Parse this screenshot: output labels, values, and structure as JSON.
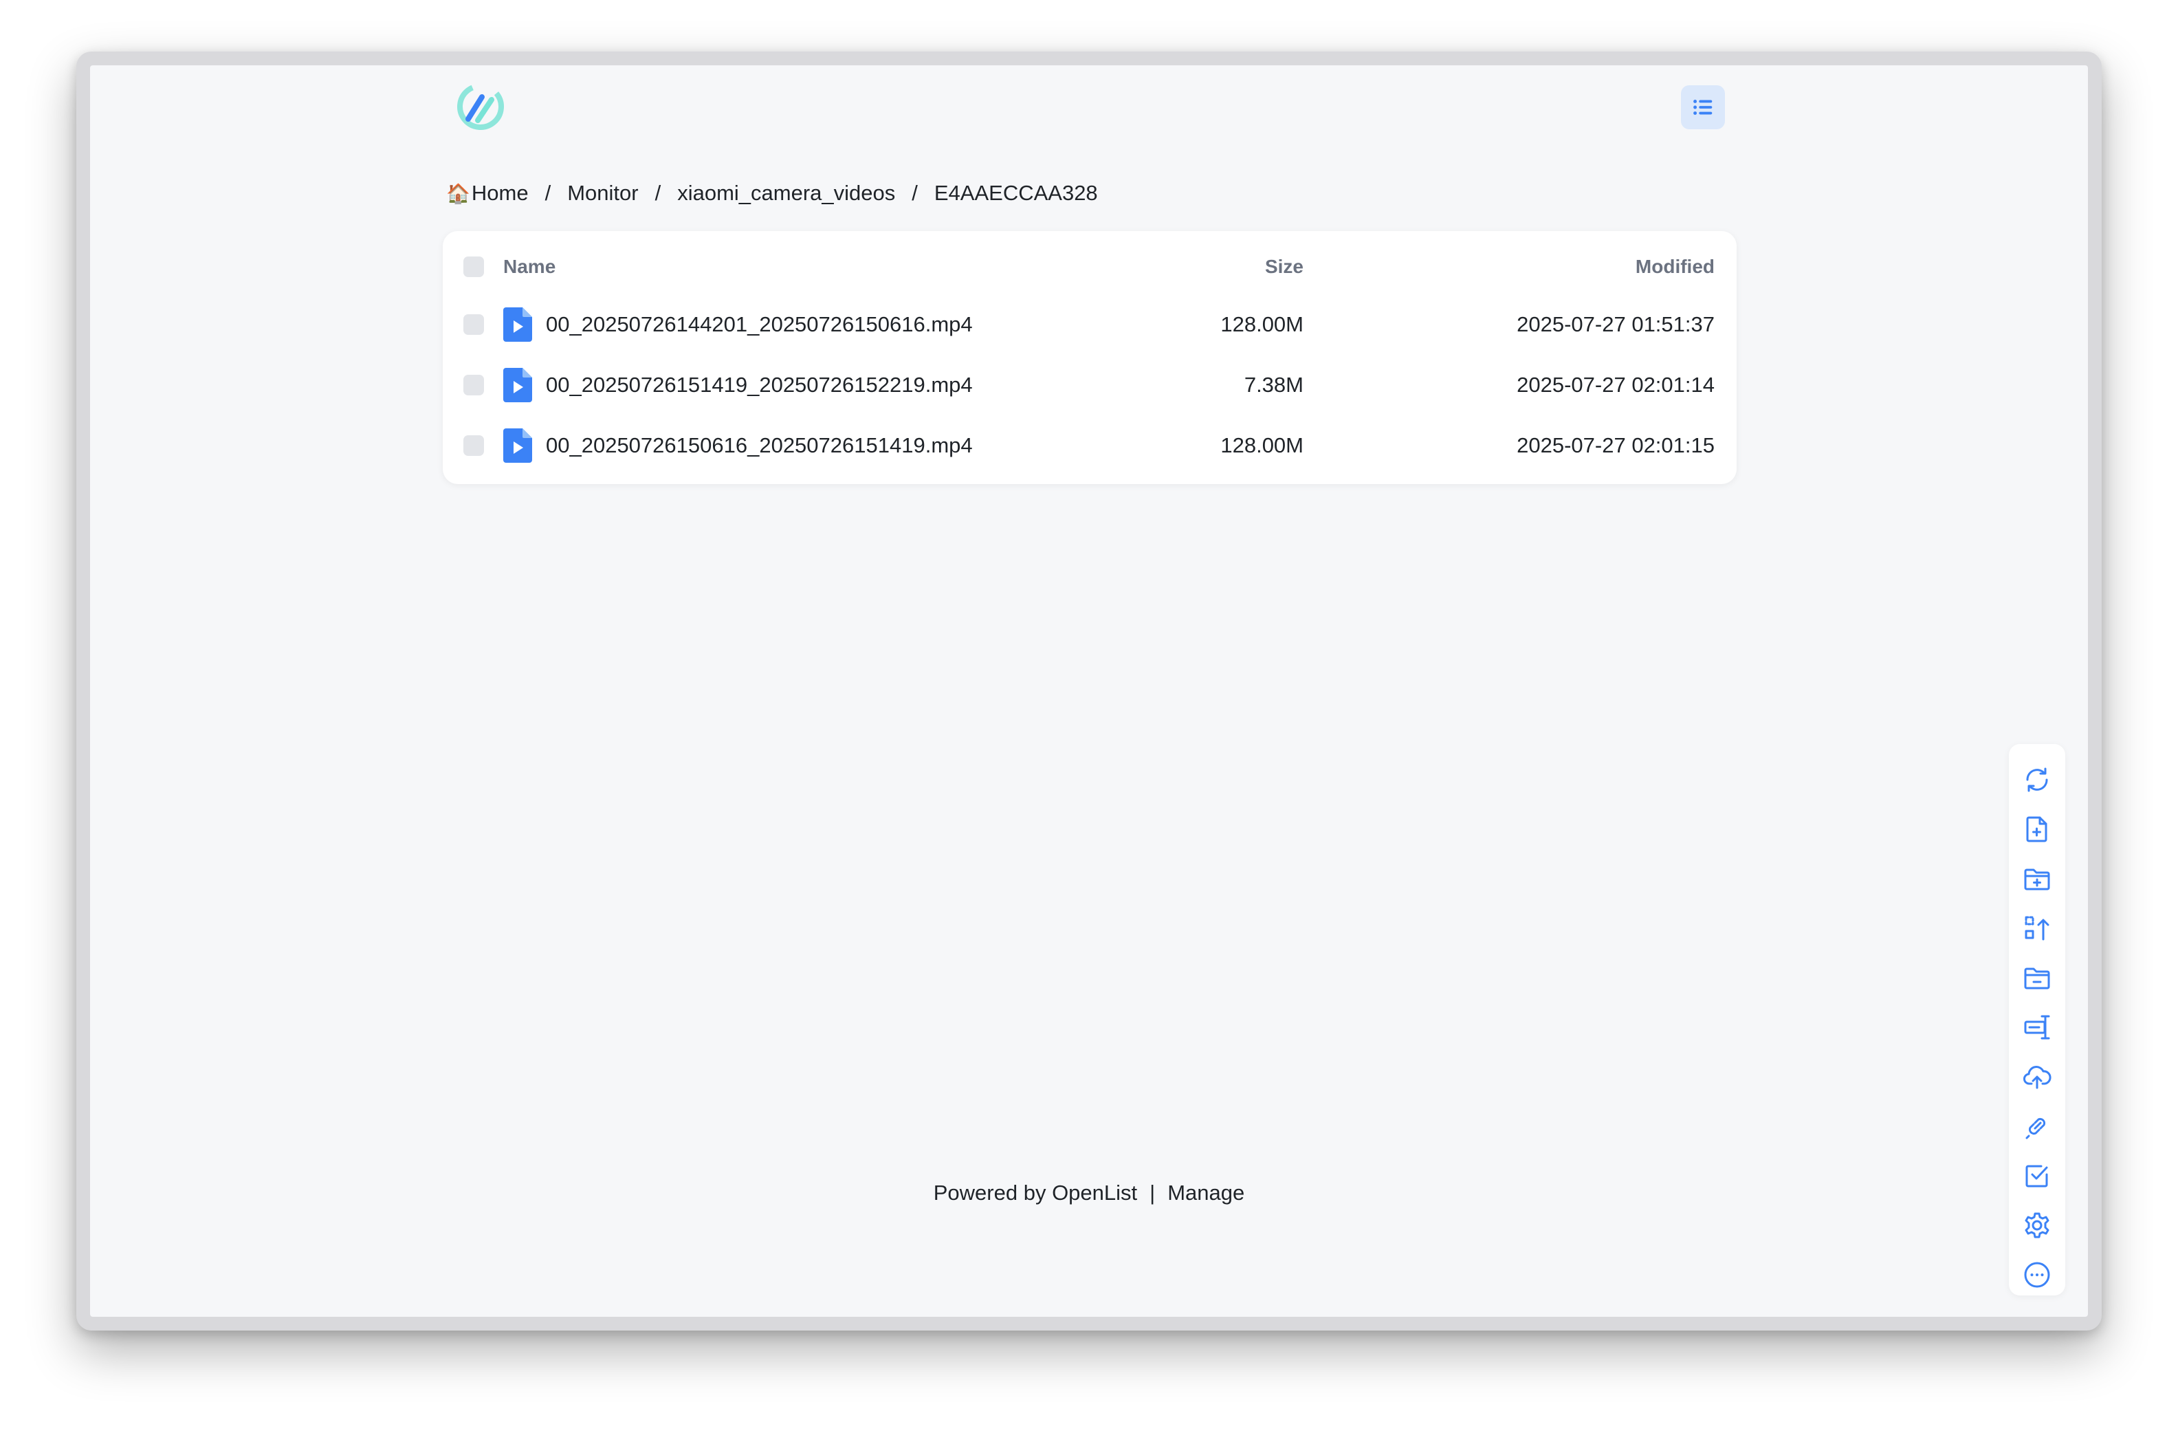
{
  "breadcrumb": {
    "home_emoji": "🏠",
    "items": [
      "Home",
      "Monitor",
      "xiaomi_camera_videos",
      "E4AAECCAA328"
    ],
    "separator": "/"
  },
  "table": {
    "headers": {
      "name": "Name",
      "size": "Size",
      "modified": "Modified"
    },
    "rows": [
      {
        "name": "00_20250726144201_20250726150616.mp4",
        "size": "128.00M",
        "modified": "2025-07-27 01:51:37",
        "icon": "video-file-icon"
      },
      {
        "name": "00_20250726151419_20250726152219.mp4",
        "size": "7.38M",
        "modified": "2025-07-27 02:01:14",
        "icon": "video-file-icon"
      },
      {
        "name": "00_20250726150616_20250726151419.mp4",
        "size": "128.00M",
        "modified": "2025-07-27 02:01:15",
        "icon": "video-file-icon"
      }
    ]
  },
  "footer": {
    "powered_by": "Powered by OpenList",
    "divider": "|",
    "manage": "Manage"
  },
  "toolbar": {
    "icons": [
      "refresh-icon",
      "new-file-icon",
      "new-folder-icon",
      "sort-icon",
      "delete-folder-icon",
      "rename-icon",
      "upload-icon",
      "link-icon",
      "select-icon",
      "settings-icon",
      "more-icon"
    ]
  },
  "colors": {
    "accent": "#3b82f6",
    "background": "#f6f7f9",
    "card": "#ffffff",
    "toggle_bg": "#dbe8fb",
    "logo_teal": "#79e3d6"
  }
}
